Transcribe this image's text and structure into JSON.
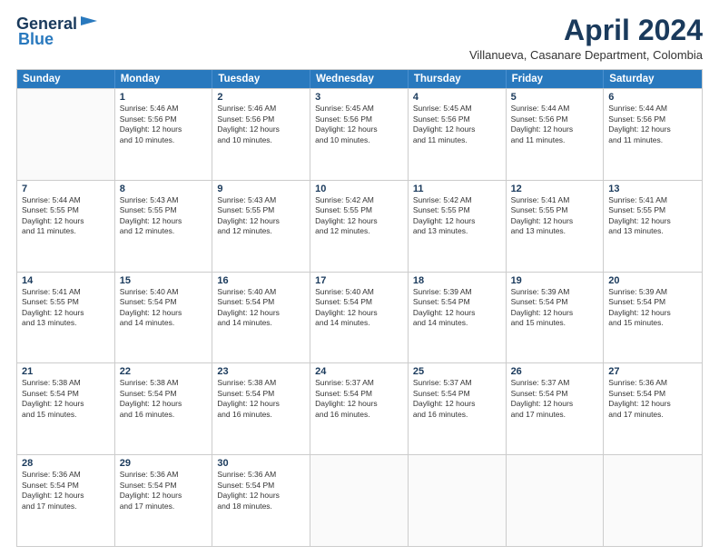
{
  "header": {
    "logo_line1": "General",
    "logo_line2": "Blue",
    "month_year": "April 2024",
    "location": "Villanueva, Casanare Department, Colombia"
  },
  "weekdays": [
    "Sunday",
    "Monday",
    "Tuesday",
    "Wednesday",
    "Thursday",
    "Friday",
    "Saturday"
  ],
  "rows": [
    [
      {
        "day": "",
        "text": ""
      },
      {
        "day": "1",
        "text": "Sunrise: 5:46 AM\nSunset: 5:56 PM\nDaylight: 12 hours\nand 10 minutes."
      },
      {
        "day": "2",
        "text": "Sunrise: 5:46 AM\nSunset: 5:56 PM\nDaylight: 12 hours\nand 10 minutes."
      },
      {
        "day": "3",
        "text": "Sunrise: 5:45 AM\nSunset: 5:56 PM\nDaylight: 12 hours\nand 10 minutes."
      },
      {
        "day": "4",
        "text": "Sunrise: 5:45 AM\nSunset: 5:56 PM\nDaylight: 12 hours\nand 11 minutes."
      },
      {
        "day": "5",
        "text": "Sunrise: 5:44 AM\nSunset: 5:56 PM\nDaylight: 12 hours\nand 11 minutes."
      },
      {
        "day": "6",
        "text": "Sunrise: 5:44 AM\nSunset: 5:56 PM\nDaylight: 12 hours\nand 11 minutes."
      }
    ],
    [
      {
        "day": "7",
        "text": "Sunrise: 5:44 AM\nSunset: 5:55 PM\nDaylight: 12 hours\nand 11 minutes."
      },
      {
        "day": "8",
        "text": "Sunrise: 5:43 AM\nSunset: 5:55 PM\nDaylight: 12 hours\nand 12 minutes."
      },
      {
        "day": "9",
        "text": "Sunrise: 5:43 AM\nSunset: 5:55 PM\nDaylight: 12 hours\nand 12 minutes."
      },
      {
        "day": "10",
        "text": "Sunrise: 5:42 AM\nSunset: 5:55 PM\nDaylight: 12 hours\nand 12 minutes."
      },
      {
        "day": "11",
        "text": "Sunrise: 5:42 AM\nSunset: 5:55 PM\nDaylight: 12 hours\nand 13 minutes."
      },
      {
        "day": "12",
        "text": "Sunrise: 5:41 AM\nSunset: 5:55 PM\nDaylight: 12 hours\nand 13 minutes."
      },
      {
        "day": "13",
        "text": "Sunrise: 5:41 AM\nSunset: 5:55 PM\nDaylight: 12 hours\nand 13 minutes."
      }
    ],
    [
      {
        "day": "14",
        "text": "Sunrise: 5:41 AM\nSunset: 5:55 PM\nDaylight: 12 hours\nand 13 minutes."
      },
      {
        "day": "15",
        "text": "Sunrise: 5:40 AM\nSunset: 5:54 PM\nDaylight: 12 hours\nand 14 minutes."
      },
      {
        "day": "16",
        "text": "Sunrise: 5:40 AM\nSunset: 5:54 PM\nDaylight: 12 hours\nand 14 minutes."
      },
      {
        "day": "17",
        "text": "Sunrise: 5:40 AM\nSunset: 5:54 PM\nDaylight: 12 hours\nand 14 minutes."
      },
      {
        "day": "18",
        "text": "Sunrise: 5:39 AM\nSunset: 5:54 PM\nDaylight: 12 hours\nand 14 minutes."
      },
      {
        "day": "19",
        "text": "Sunrise: 5:39 AM\nSunset: 5:54 PM\nDaylight: 12 hours\nand 15 minutes."
      },
      {
        "day": "20",
        "text": "Sunrise: 5:39 AM\nSunset: 5:54 PM\nDaylight: 12 hours\nand 15 minutes."
      }
    ],
    [
      {
        "day": "21",
        "text": "Sunrise: 5:38 AM\nSunset: 5:54 PM\nDaylight: 12 hours\nand 15 minutes."
      },
      {
        "day": "22",
        "text": "Sunrise: 5:38 AM\nSunset: 5:54 PM\nDaylight: 12 hours\nand 16 minutes."
      },
      {
        "day": "23",
        "text": "Sunrise: 5:38 AM\nSunset: 5:54 PM\nDaylight: 12 hours\nand 16 minutes."
      },
      {
        "day": "24",
        "text": "Sunrise: 5:37 AM\nSunset: 5:54 PM\nDaylight: 12 hours\nand 16 minutes."
      },
      {
        "day": "25",
        "text": "Sunrise: 5:37 AM\nSunset: 5:54 PM\nDaylight: 12 hours\nand 16 minutes."
      },
      {
        "day": "26",
        "text": "Sunrise: 5:37 AM\nSunset: 5:54 PM\nDaylight: 12 hours\nand 17 minutes."
      },
      {
        "day": "27",
        "text": "Sunrise: 5:36 AM\nSunset: 5:54 PM\nDaylight: 12 hours\nand 17 minutes."
      }
    ],
    [
      {
        "day": "28",
        "text": "Sunrise: 5:36 AM\nSunset: 5:54 PM\nDaylight: 12 hours\nand 17 minutes."
      },
      {
        "day": "29",
        "text": "Sunrise: 5:36 AM\nSunset: 5:54 PM\nDaylight: 12 hours\nand 17 minutes."
      },
      {
        "day": "30",
        "text": "Sunrise: 5:36 AM\nSunset: 5:54 PM\nDaylight: 12 hours\nand 18 minutes."
      },
      {
        "day": "",
        "text": ""
      },
      {
        "day": "",
        "text": ""
      },
      {
        "day": "",
        "text": ""
      },
      {
        "day": "",
        "text": ""
      }
    ]
  ]
}
